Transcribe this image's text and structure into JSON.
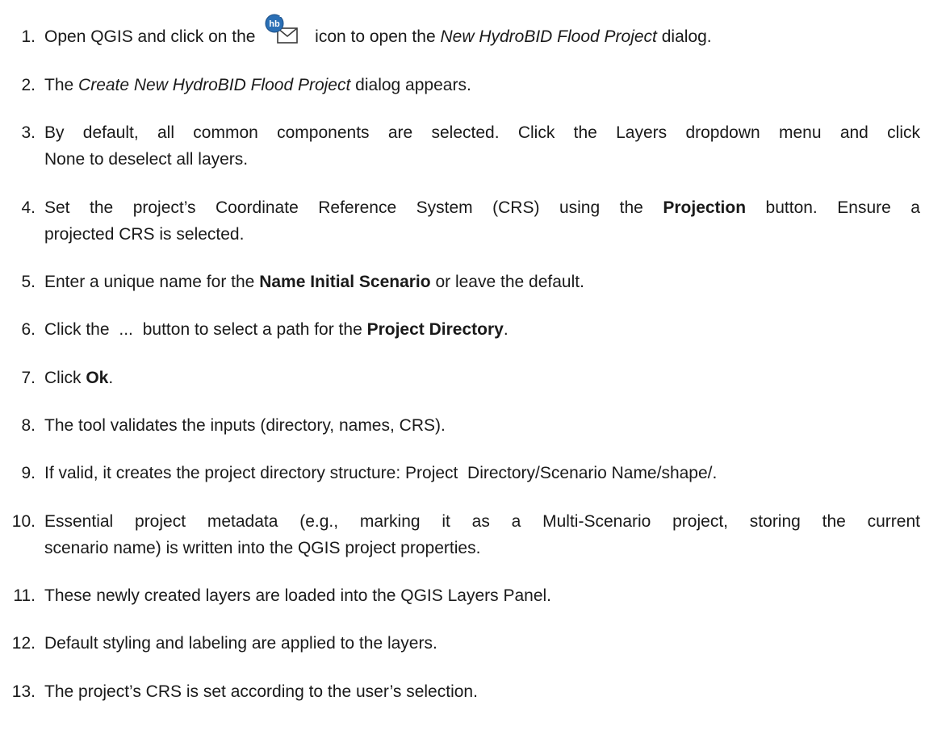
{
  "steps": [
    {
      "num": "1.",
      "pre": "Open QGIS and click on the",
      "icon": "hydrobid-new-project-icon",
      "post_pre": "icon to open the",
      "italic": "New HydroBID Flood Project",
      "post": "dialog."
    },
    {
      "num": "2.",
      "pre": "The",
      "italic": "Create New HydroBID Flood Project",
      "post": "dialog appears."
    },
    {
      "num": "3.",
      "line1": "By default, all common components are selected. Click the Layers dropdown menu and click",
      "line2": "None to deselect all layers."
    },
    {
      "num": "4.",
      "line1_pre": "Set the project’s Coordinate Reference System (CRS) using the",
      "line1_bold": "Projection",
      "line1_post": "button. Ensure a",
      "line2": "projected CRS is selected."
    },
    {
      "num": "5.",
      "pre": "Enter a unique name for the",
      "bold": "Name Initial Scenario",
      "post": "or leave the default."
    },
    {
      "num": "6.",
      "pre": "Click the",
      "button": "...",
      "mid": "button to select a path for the",
      "bold": "Project Directory",
      "post": "."
    },
    {
      "num": "7.",
      "pre": "Click",
      "bold": "Ok",
      "post": "."
    },
    {
      "num": "8.",
      "text": "The tool validates the inputs (directory, names, CRS)."
    },
    {
      "num": "9.",
      "text": "If valid, it creates the project directory structure: Project  Directory/Scenario Name/shape/."
    },
    {
      "num": "10.",
      "line1": "Essential project metadata (e.g., marking it as a Multi-Scenario project, storing the current",
      "line2": "scenario name) is written into the QGIS project properties."
    },
    {
      "num": "11.",
      "text": "These newly created layers are loaded into the QGIS Layers Panel."
    },
    {
      "num": "12.",
      "text": "Default styling and labeling are applied to the layers."
    },
    {
      "num": "13.",
      "text": "The project’s CRS is set according to the user’s selection."
    }
  ],
  "colors": {
    "icon_badge": "#2a6fb5",
    "icon_outline": "#3a3a3a"
  }
}
